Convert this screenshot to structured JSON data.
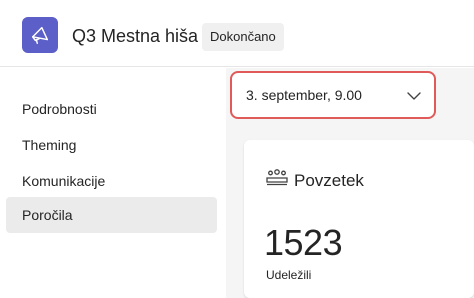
{
  "header": {
    "app_icon": "megaphone-icon",
    "title": "Q3 Mestna hiša",
    "status": "Dokončano"
  },
  "colors": {
    "accent": "#5b5fc7",
    "focus_border": "#e05a5a",
    "active_nav": "#ebebeb",
    "main_bg": "#f5f5f5"
  },
  "sidebar": {
    "items": [
      {
        "label": "Podrobnosti",
        "active": false
      },
      {
        "label": "Theming",
        "active": false
      },
      {
        "label": "Komunikacije",
        "active": false
      },
      {
        "label": "Poročila",
        "active": true
      }
    ]
  },
  "main": {
    "date_select": {
      "value": "3. september, 9.00",
      "icon": "chevron-down-icon"
    },
    "summary": {
      "icon": "people-group-icon",
      "title": "Povzetek",
      "value": "1523",
      "label": "Udeležili"
    }
  }
}
